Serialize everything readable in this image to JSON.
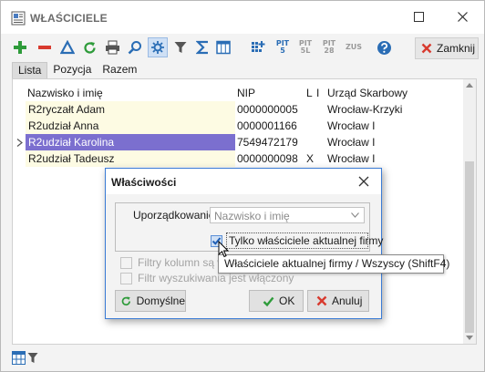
{
  "window": {
    "title": "WŁAŚCICIELE"
  },
  "toolbar": {
    "items": [
      "plus-icon",
      "minus-icon",
      "triangle-icon",
      "refresh-icon",
      "print-icon",
      "search-icon",
      "settings-icon",
      "filter-icon",
      "sigma-icon",
      "columns-icon",
      "grid-add-icon",
      "pit5-icon",
      "pit5l-icon",
      "pit28-icon",
      "zus-icon",
      "help-icon"
    ],
    "pit5": [
      "PIT",
      "5"
    ],
    "pit5l": [
      "PIT",
      "5L"
    ],
    "pit28": [
      "PIT",
      "28"
    ],
    "zus": "ZUS",
    "close_label": "Zamknij"
  },
  "tabs": [
    "Lista",
    "Pozycja",
    "Razem"
  ],
  "table": {
    "headers": {
      "name": "Nazwisko i imię",
      "nip": "NIP",
      "l": "L",
      "i": "I",
      "office": "Urząd Skarbowy"
    },
    "rows": [
      {
        "name": "R2ryczałt Adam",
        "nip": "0000000005",
        "l": "",
        "i": "",
        "office": "Wrocław-Krzyki"
      },
      {
        "name": "R2udział Anna",
        "nip": "0000001166",
        "l": "",
        "i": "",
        "office": "Wrocław I"
      },
      {
        "name": "R2udział Karolina",
        "nip": "7549472179",
        "l": "",
        "i": "",
        "office": "Wrocław I"
      },
      {
        "name": "R2udział Tadeusz",
        "nip": "0000000098",
        "l": "X",
        "i": "",
        "office": "Wrocław I"
      }
    ],
    "selected_index": 2
  },
  "dialog": {
    "title": "Właściwości",
    "order_label": "Uporządkowanie",
    "order_value": "Nazwisko i imię",
    "only_current_label": "Tylko właściciele aktualnej firmy",
    "only_current_checked": true,
    "filter_columns_label": "Filtry kolumn są wł",
    "filter_search_label": "Filtr wyszukiwania jest włączony",
    "default_button": "Domyślne",
    "ok_button": "OK",
    "cancel_button": "Anuluj"
  },
  "tooltip": {
    "text": "Właściciele aktualnej firmy / Wszyscy (ShiftF4)"
  },
  "colors": {
    "accent": "#3a7bd5",
    "selection": "#7b6fcf",
    "name_column_bg": "#fdfbe3",
    "icon_blue": "#2a6db5",
    "icon_green": "#2e9b3a",
    "icon_red": "#d83a2e"
  }
}
